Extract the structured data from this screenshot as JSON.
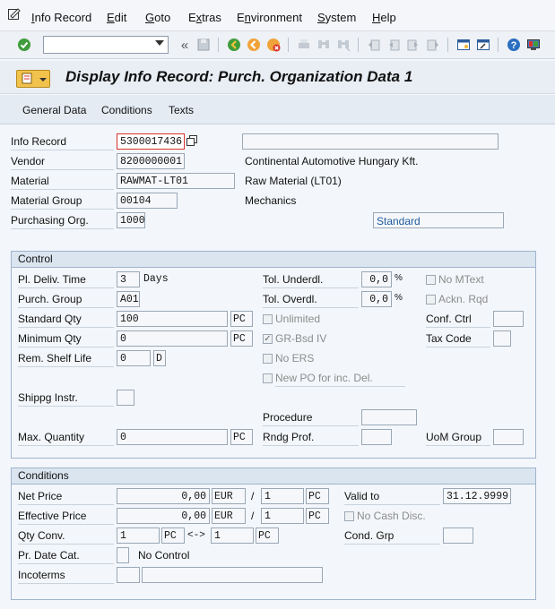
{
  "menu": {
    "items": [
      "Info Record",
      "Edit",
      "Goto",
      "Extras",
      "Environment",
      "System",
      "Help"
    ],
    "hotkeys": [
      "I",
      "E",
      "G",
      "x",
      "n",
      "S",
      "H"
    ]
  },
  "toolbar": {
    "command_field_value": "",
    "icons": [
      "enter-icon",
      "save-icon",
      "back-icon",
      "exit-icon",
      "cancel-icon",
      "print-icon",
      "find-icon",
      "find-next-icon",
      "first-page-icon",
      "previous-page-icon",
      "next-page-icon",
      "last-page-icon",
      "create-session-icon",
      "shortcut-icon",
      "help-icon",
      "customize-layout-icon"
    ]
  },
  "title": "Display Info Record: Purch. Organization Data 1",
  "app_toolbar": {
    "general_data": "General Data",
    "conditions": "Conditions",
    "texts": "Texts"
  },
  "header": {
    "info_record_label": "Info Record",
    "info_record_value": "5300017436",
    "vendor_label": "Vendor",
    "vendor_value": "8200000001",
    "vendor_name": "Continental Automotive Hungary Kft.",
    "material_label": "Material",
    "material_value": "RAWMAT-LT01",
    "material_desc": "Raw Material (LT01)",
    "material_group_label": "Material Group",
    "material_group_value": "00104",
    "material_group_desc": "Mechanics",
    "purch_org_label": "Purchasing Org.",
    "purch_org_value": "1000",
    "category_value": "Standard",
    "short_text_value": ""
  },
  "control": {
    "title": "Control",
    "pl_deliv_time_label": "Pl. Deliv. Time",
    "pl_deliv_time_value": "3",
    "days_label": "Days",
    "purch_group_label": "Purch. Group",
    "purch_group_value": "A01",
    "standard_qty_label": "Standard Qty",
    "standard_qty_value": "100",
    "standard_qty_unit": "PC",
    "minimum_qty_label": "Minimum Qty",
    "minimum_qty_value": "0",
    "minimum_qty_unit": "PC",
    "rem_shelf_life_label": "Rem. Shelf Life",
    "rem_shelf_life_value": "0",
    "rem_shelf_life_unit": "D",
    "shippg_instr_label": "Shippg Instr.",
    "shippg_instr_value": "",
    "max_quantity_label": "Max. Quantity",
    "max_quantity_value": "0",
    "max_quantity_unit": "PC",
    "tol_underdl_label": "Tol. Underdl.",
    "tol_underdl_value": "0,0",
    "tol_overdl_label": "Tol. Overdl.",
    "tol_overdl_value": "0,0",
    "percent": "%",
    "unlimited_label": "Unlimited",
    "unlimited_checked": false,
    "gr_bsd_iv_label": "GR-Bsd IV",
    "gr_bsd_iv_checked": true,
    "no_ers_label": "No ERS",
    "no_ers_checked": false,
    "new_po_label": "New PO for inc. Del.",
    "new_po_checked": false,
    "procedure_label": "Procedure",
    "procedure_value": "",
    "rndg_prof_label": "Rndg Prof.",
    "rndg_prof_value": "",
    "no_mtext_label": "No MText",
    "no_mtext_checked": false,
    "ackn_rqd_label": "Ackn. Rqd",
    "ackn_rqd_checked": false,
    "conf_ctrl_label": "Conf. Ctrl",
    "conf_ctrl_value": "",
    "tax_code_label": "Tax Code",
    "tax_code_value": "",
    "uom_group_label": "UoM Group",
    "uom_group_value": ""
  },
  "conditions": {
    "title": "Conditions",
    "net_price_label": "Net Price",
    "net_price_value": "0,00",
    "net_price_currency": "EUR",
    "slash": "/",
    "net_price_per": "1",
    "net_price_unit": "PC",
    "effective_price_label": "Effective Price",
    "effective_price_value": "0,00",
    "effective_price_currency": "EUR",
    "effective_price_per": "1",
    "effective_price_unit": "PC",
    "qty_conv_label": "Qty Conv.",
    "qty_conv_from": "1",
    "qty_conv_from_unit": "PC",
    "qty_conv_arrow": "<->",
    "qty_conv_to": "1",
    "qty_conv_to_unit": "PC",
    "pr_date_cat_label": "Pr. Date Cat.",
    "pr_date_cat_value": "",
    "pr_date_cat_desc": "No Control",
    "incoterms_label": "Incoterms",
    "incoterms_value": "",
    "incoterms_desc": "",
    "valid_to_label": "Valid to",
    "valid_to_value": "31.12.9999",
    "no_cash_disc_label": "No Cash Disc.",
    "no_cash_disc_checked": false,
    "cond_grp_label": "Cond. Grp",
    "cond_grp_value": ""
  },
  "colors": {
    "accent_blue": "#1f5a9a",
    "header_bg": "#dbe5f0",
    "group_border": "#9fb4cc",
    "required_red": "#d9322b"
  }
}
